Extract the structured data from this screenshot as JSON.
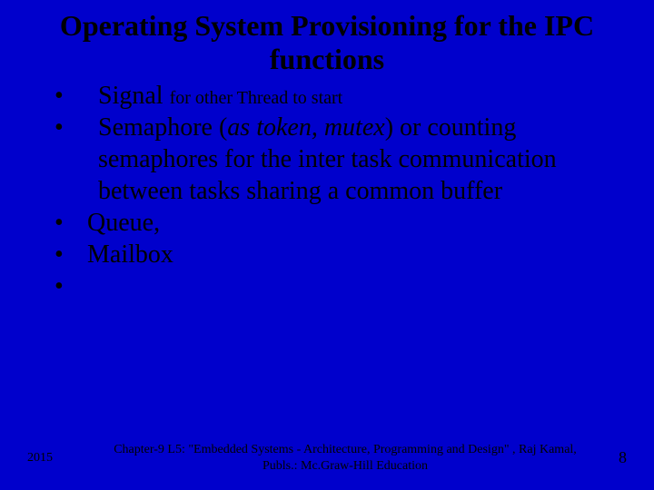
{
  "title": "Operating System Provisioning for the IPC functions",
  "bullets": {
    "b1_lead": "Signal ",
    "b1_rest": "for other Thread to start",
    "b2_lead": "Semaphore (",
    "b2_ital": "as token, mutex",
    "b2_rest": ") or counting semaphores for the inter task communication between tasks sharing a common buffer",
    "b3": "Queue,",
    "b4": "Mailbox",
    "b5": ""
  },
  "footer": {
    "year": "2015",
    "citation": "Chapter-9 L5: \"Embedded Systems - Architecture, Programming and Design\" , Raj Kamal, Publs.: Mc.Graw-Hill Education",
    "page": "8"
  }
}
